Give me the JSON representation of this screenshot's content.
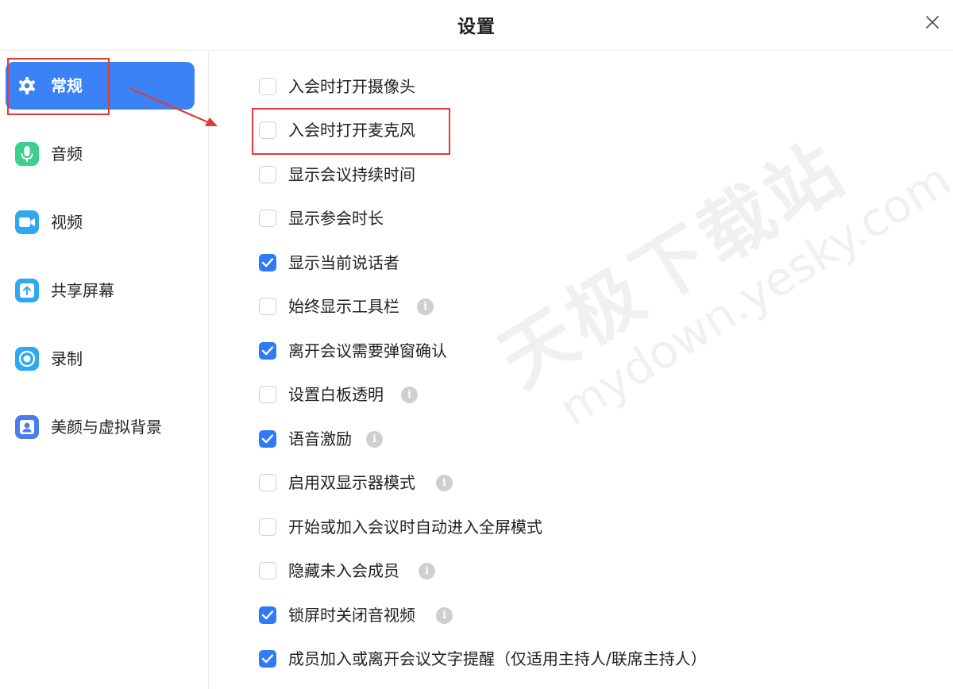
{
  "window": {
    "title": "设置"
  },
  "sidebar": {
    "items": [
      {
        "label": "常规",
        "icon": "gear-icon",
        "active": true,
        "color": "#3b82f6"
      },
      {
        "label": "音频",
        "icon": "microphone-icon",
        "active": false,
        "color": "#3ecf8e"
      },
      {
        "label": "视频",
        "icon": "video-camera-icon",
        "active": false,
        "color": "#2ea8f0"
      },
      {
        "label": "共享屏幕",
        "icon": "share-screen-icon",
        "active": false,
        "color": "#2ea8f0"
      },
      {
        "label": "录制",
        "icon": "record-icon",
        "active": false,
        "color": "#2ea8f0"
      },
      {
        "label": "美颜与虚拟背景",
        "icon": "portrait-icon",
        "active": false,
        "color": "#4a7cf0"
      }
    ]
  },
  "options": [
    {
      "label": "入会时打开摄像头",
      "checked": false,
      "info": false
    },
    {
      "label": "入会时打开麦克风",
      "checked": false,
      "info": false
    },
    {
      "label": "显示会议持续时间",
      "checked": false,
      "info": false
    },
    {
      "label": "显示参会时长",
      "checked": false,
      "info": false
    },
    {
      "label": "显示当前说话者",
      "checked": true,
      "info": false
    },
    {
      "label": "始终显示工具栏",
      "checked": false,
      "info": true
    },
    {
      "label": "离开会议需要弹窗确认",
      "checked": true,
      "info": false
    },
    {
      "label": "设置白板透明",
      "checked": false,
      "info": true
    },
    {
      "label": "语音激励",
      "checked": true,
      "info": true
    },
    {
      "label": "启用双显示器模式",
      "checked": false,
      "info": true
    },
    {
      "label": "开始或加入会议时自动进入全屏模式",
      "checked": false,
      "info": false
    },
    {
      "label": "隐藏未入会成员",
      "checked": false,
      "info": true
    },
    {
      "label": "锁屏时关闭音视频",
      "checked": true,
      "info": true
    },
    {
      "label": "成员加入或离开会议文字提醒（仅适用主持人/联席主持人）",
      "checked": true,
      "info": false
    }
  ],
  "watermark": {
    "cn": "天极下载站",
    "en": "mydown.yesky.com"
  },
  "colors": {
    "accent": "#2f7bf5",
    "annotation": "#e53935"
  }
}
